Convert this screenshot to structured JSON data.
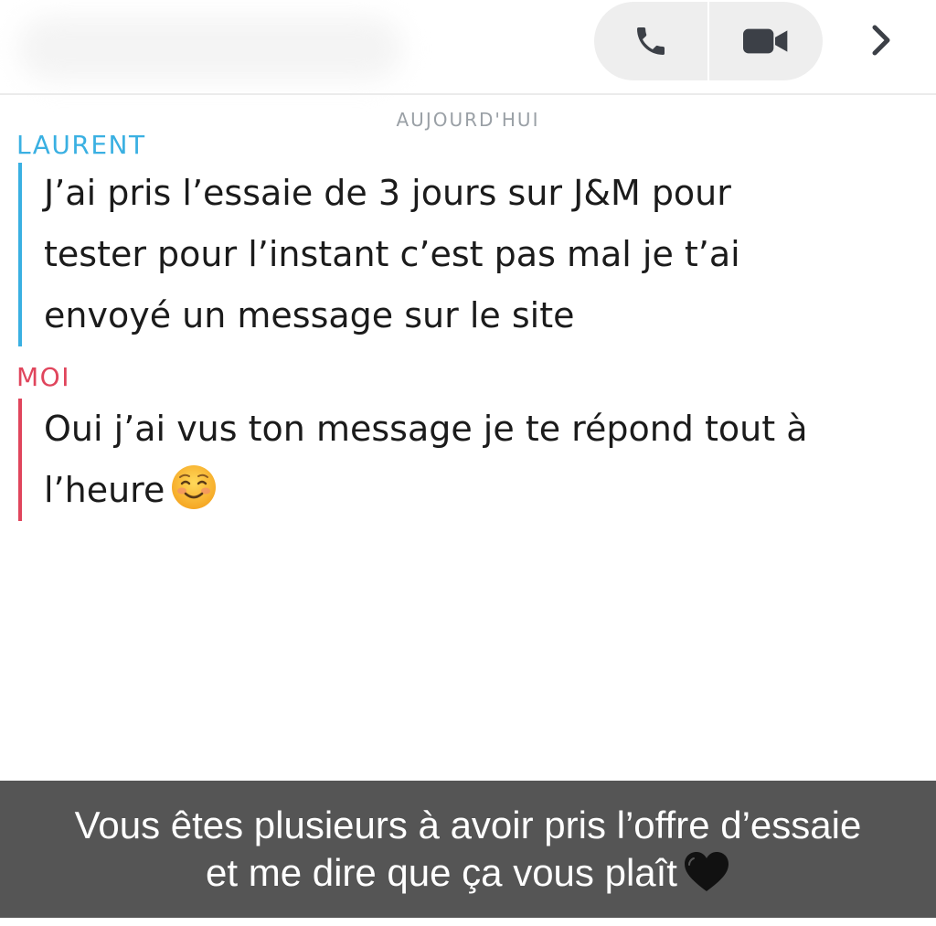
{
  "header": {
    "call_button_icon": "phone-icon",
    "video_button_icon": "video-camera-icon",
    "more_icon": "chevron-right-icon"
  },
  "conversation": {
    "date_label": "AUJOURD'HUI",
    "messages": [
      {
        "sender": "LAURENT",
        "sender_color": "#3ab0e2",
        "lines": [
          "J’ai pris l’essaie de 3 jours sur J&M pour",
          "tester pour l’instant c’est pas mal je t’ai",
          "envoyé un message sur le site"
        ]
      },
      {
        "sender": "MOI",
        "sender_color": "#e0455c",
        "lines": [
          "Oui j’ai vus ton message je te répond tout à",
          "l’heure"
        ],
        "emoji": "smiling-face-icon"
      }
    ]
  },
  "caption": {
    "line1": "Vous êtes plusieurs à avoir pris l’offre d’essaie",
    "line2": "et me dire que ça vous plaît",
    "emoji": "black-heart-icon"
  }
}
